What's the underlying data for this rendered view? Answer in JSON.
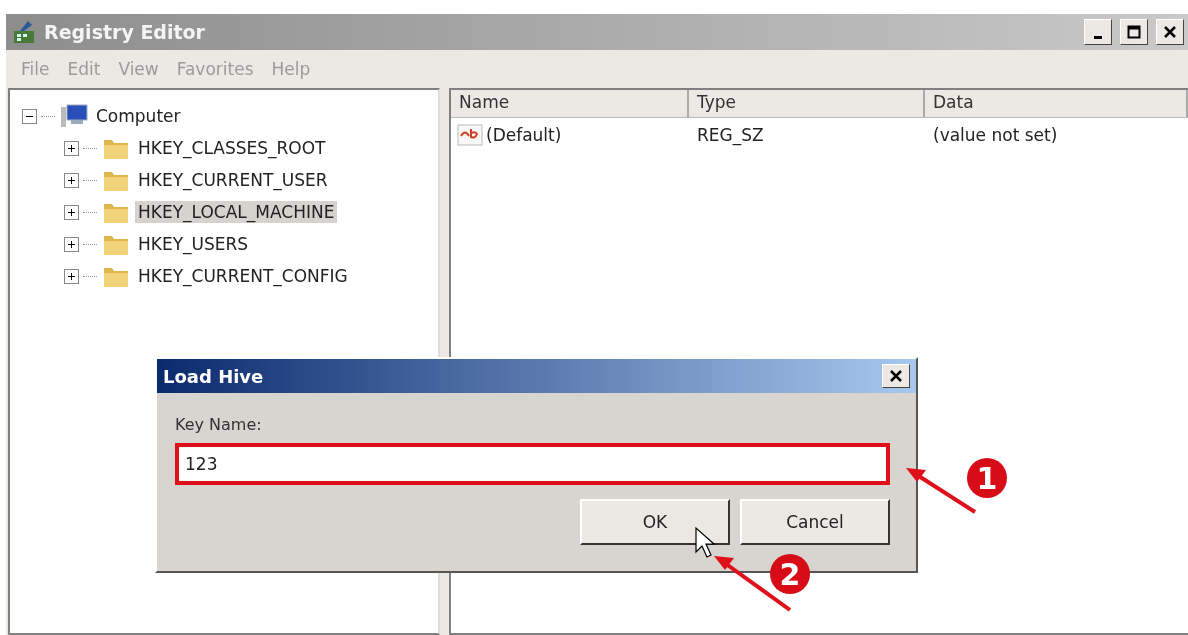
{
  "window": {
    "title": "Registry Editor",
    "controls": [
      {
        "kind": "minimize"
      },
      {
        "kind": "maximize"
      },
      {
        "kind": "close"
      }
    ]
  },
  "menu": [
    "File",
    "Edit",
    "View",
    "Favorites",
    "Help"
  ],
  "tree": [
    {
      "label": "Computer",
      "kind": "computer",
      "expanded": true,
      "selected": false,
      "children": [
        {
          "label": "HKEY_CLASSES_ROOT",
          "kind": "folder",
          "expanded": false,
          "selected": false
        },
        {
          "label": "HKEY_CURRENT_USER",
          "kind": "folder",
          "expanded": false,
          "selected": false
        },
        {
          "label": "HKEY_LOCAL_MACHINE",
          "kind": "folder",
          "expanded": false,
          "selected": true
        },
        {
          "label": "HKEY_USERS",
          "kind": "folder",
          "expanded": false,
          "selected": false
        },
        {
          "label": "HKEY_CURRENT_CONFIG",
          "kind": "folder",
          "expanded": false,
          "selected": false
        }
      ]
    }
  ],
  "table": {
    "columns": [
      "Name",
      "Type",
      "Data"
    ],
    "rows": [
      {
        "name": "(Default)",
        "type": "REG_SZ",
        "data": "(value not set)"
      }
    ]
  },
  "dialog": {
    "title": "Load Hive",
    "label": "Key Name:",
    "value": "123",
    "highlighted": true,
    "buttons": [
      "OK",
      "Cancel"
    ]
  },
  "annotations": [
    {
      "label": "1"
    },
    {
      "label": "2"
    }
  ]
}
